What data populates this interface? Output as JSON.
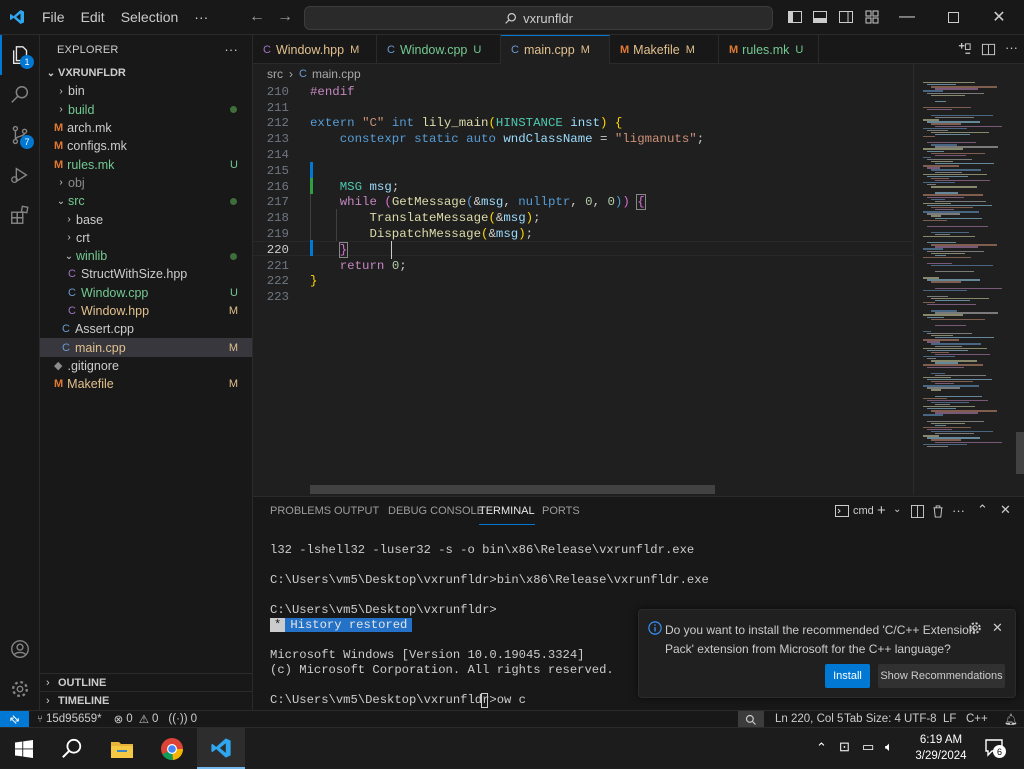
{
  "menu": {
    "file": "File",
    "edit": "Edit",
    "selection": "Selection",
    "more": "···"
  },
  "command_center": {
    "text": "vxrunfldr"
  },
  "activity_badges": {
    "explorer": "1",
    "scm": "7"
  },
  "explorer": {
    "header": "EXPLORER",
    "more": "···",
    "root": "VXRUNFLDR",
    "items": [
      {
        "label": "bin",
        "kind": "folder",
        "status": "",
        "color": "#cccccc"
      },
      {
        "label": "build",
        "kind": "folder",
        "status": "",
        "color": "#73c991"
      },
      {
        "label": "arch.mk",
        "kind": "file",
        "status": "",
        "color": "#cccccc"
      },
      {
        "label": "configs.mk",
        "kind": "file",
        "status": "",
        "color": "#cccccc"
      },
      {
        "label": "rules.mk",
        "kind": "file",
        "status": "U",
        "color": "#73c991"
      },
      {
        "label": "obj",
        "kind": "folder",
        "status": "",
        "color": "#8c8c8c"
      },
      {
        "label": "src",
        "kind": "folder",
        "status": "",
        "color": "#73c991"
      },
      {
        "label": "base",
        "kind": "folder",
        "status": "",
        "color": "#cccccc"
      },
      {
        "label": "crt",
        "kind": "folder",
        "status": "",
        "color": "#cccccc"
      },
      {
        "label": "winlib",
        "kind": "folder",
        "status": "",
        "color": "#73c991"
      },
      {
        "label": "StructWithSize.hpp",
        "kind": "file",
        "status": "",
        "color": "#cccccc"
      },
      {
        "label": "Window.cpp",
        "kind": "file",
        "status": "U",
        "color": "#73c991"
      },
      {
        "label": "Window.hpp",
        "kind": "file",
        "status": "M",
        "color": "#e2c08d"
      },
      {
        "label": "Assert.cpp",
        "kind": "file",
        "status": "",
        "color": "#cccccc"
      },
      {
        "label": "main.cpp",
        "kind": "file",
        "status": "M",
        "color": "#e2c08d"
      },
      {
        "label": ".gitignore",
        "kind": "file",
        "status": "",
        "color": "#cccccc"
      },
      {
        "label": "Makefile",
        "kind": "file",
        "status": "M",
        "color": "#e2c08d"
      }
    ],
    "outline": "OUTLINE",
    "timeline": "TIMELINE"
  },
  "tabs": [
    {
      "label": "Window.hpp",
      "status": "M",
      "color": "#e2c08d",
      "active": false
    },
    {
      "label": "Window.cpp",
      "status": "U",
      "color": "#73c991",
      "active": false
    },
    {
      "label": "main.cpp",
      "status": "M",
      "color": "#e2c08d",
      "active": true
    },
    {
      "label": "Makefile",
      "status": "M",
      "color": "#e2c08d",
      "active": false
    },
    {
      "label": "rules.mk",
      "status": "U",
      "color": "#73c991",
      "active": false
    }
  ],
  "breadcrumb": {
    "folder": "src",
    "sep": "›",
    "file": "main.cpp"
  },
  "editor": {
    "line_numbers": [
      "210",
      "211",
      "212",
      "213",
      "214",
      "215",
      "216",
      "217",
      "218",
      "219",
      "220",
      "221",
      "222",
      "223"
    ]
  },
  "panel": {
    "tabs": [
      "PROBLEMS",
      "OUTPUT",
      "DEBUG CONSOLE",
      "TERMINAL",
      "PORTS"
    ],
    "active_tab": "TERMINAL",
    "shell": "cmd",
    "terminal_lines": [
      "l32 -lshell32 -luser32 -s -o bin\\x86\\Release\\vxrunfldr.exe",
      "",
      "C:\\Users\\vm5\\Desktop\\vxrunfldr>bin\\x86\\Release\\vxrunfldr.exe",
      "",
      "C:\\Users\\vm5\\Desktop\\vxrunfldr>",
      "",
      "",
      "Microsoft Windows [Version 10.0.19045.3324]",
      "(c) Microsoft Corporation. All rights reserved.",
      "",
      "C:\\Users\\vm5\\Desktop\\vxrunfldr>ow c"
    ],
    "history_marker": "*",
    "history_label": "History restored"
  },
  "notification": {
    "message_line1": "Do you want to install the recommended 'C/C++ Extension",
    "message_line2": "Pack' extension from Microsoft for the C++ language?",
    "install": "Install",
    "show_recommendations": "Show Recommendations"
  },
  "status": {
    "remote": "⚡",
    "branch": "15d95659*",
    "errors": "0",
    "warnings": "0",
    "ports": "0",
    "position": "Ln 220, Col 5",
    "tab_size": "Tab Size: 4",
    "encoding": "UTF-8",
    "eol": "LF",
    "language": "C++"
  },
  "taskbar": {
    "time": "6:19 AM",
    "date": "3/29/2024",
    "notif_count": "6"
  },
  "colors": {
    "accent": "#0078d4",
    "modified": "#e2c08d",
    "untracked": "#73c991",
    "background": "#1f1f1f",
    "sidebar": "#181818"
  }
}
